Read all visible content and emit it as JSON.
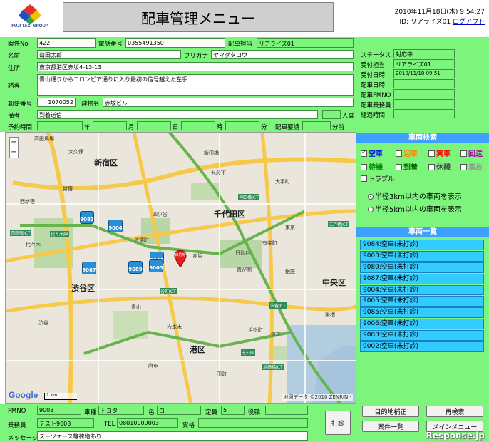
{
  "header": {
    "logo_text": "FUJI TAXI GROUP",
    "title": "配車管理メニュー",
    "datetime": "2010年11月18日(木) 9:54:27",
    "user_label": "ID: リアライズ01",
    "logout": "ログアウト"
  },
  "form": {
    "case_no_label": "案件No.",
    "case_no": "422",
    "phone_label": "電話番号",
    "phone": "0355491350",
    "dispatcher_label": "配車担当",
    "dispatcher": "リアライズ01",
    "name_label": "名前",
    "name": "山田太郎",
    "kana_label": "フリガナ",
    "kana": "ヤマダタロウ",
    "address_label": "住所",
    "address": "東京都港区赤坂4-13-13",
    "guide_label": "誘導",
    "guide": "青山通りからコロンビア通りに入り最初の信号越えた左手",
    "zip_label": "郵便番号",
    "zip": "1070052",
    "building_label": "建物名",
    "building": "赤坂ビル",
    "note_label": "備考",
    "note": "到着送信",
    "passengers_label": "人乗",
    "reserve_label": "予約時間",
    "year_label": "年",
    "month_label": "月",
    "day_label": "日",
    "hour_label": "時",
    "minute_label": "分",
    "dispatch_req_label": "配車要請",
    "minutes_after_label": "分前",
    "status_label": "ステータス",
    "status": "対応中",
    "receiver_label": "受付担当",
    "receiver": "リアライズ01",
    "received_at_label": "受付日時",
    "received_at": "2010/11/18 09:51",
    "dispatch_at_label": "配車日時",
    "fmno_label": "配車FMNO",
    "crew_label": "配車乗務員",
    "elapsed_label": "経過時間"
  },
  "vehicle_search": {
    "title": "車両検索",
    "filters": [
      {
        "label": "空車",
        "checked": true,
        "color": "#0000ff"
      },
      {
        "label": "迎車",
        "checked": false,
        "color": "#ff8800"
      },
      {
        "label": "実車",
        "checked": false,
        "color": "#ff0000"
      },
      {
        "label": "回送",
        "checked": false,
        "color": "#aa00aa"
      },
      {
        "label": "待機",
        "checked": false,
        "color": "#008800"
      },
      {
        "label": "到着",
        "checked": false,
        "color": "#006600"
      },
      {
        "label": "休憩",
        "checked": false,
        "color": "#444444"
      },
      {
        "label": "事故",
        "checked": false,
        "color": "#999999"
      },
      {
        "label": "トラブル",
        "checked": false,
        "color": "#333333"
      }
    ],
    "radius_3km": "半径3km以内の車両を表示",
    "radius_5km": "半径5km以内の車両を表示",
    "radius_selected": "3km"
  },
  "vehicle_list": {
    "title": "車両一覧",
    "items": [
      "9084:空車(未打診)",
      "9003:空車(未打診)",
      "9089:空車(未打診)",
      "9087:空車(未打診)",
      "9004:空車(未打診)",
      "9005:空車(未打診)",
      "9085:空車(未打診)",
      "9006:空車(未打診)",
      "9083:空車(未打診)",
      "9002:空車(未打診)"
    ]
  },
  "map": {
    "zoom_in": "+",
    "zoom_out": "−",
    "attribution": "地図データ ©2010 ZENRIN -",
    "logo": "Google",
    "scale_label": "1 km",
    "destination_label": "目的地",
    "areas": [
      "新宿区",
      "千代田区",
      "渋谷区",
      "港区",
      "中央区",
      "新宿",
      "大久保",
      "四ツ谷",
      "信濃町",
      "六本木",
      "赤坂",
      "青山",
      "代々木",
      "西新宿",
      "渋谷",
      "麻布",
      "霞が関",
      "有楽町",
      "日比谷",
      "銀座",
      "竹芝",
      "田町",
      "高田馬場",
      "飯田橋",
      "九段下",
      "大手町",
      "東京",
      "築地",
      "浜松町"
    ],
    "junctions": [
      "西新宿JCT",
      "代々木PA",
      "神田橋JCT",
      "江戸橋JCT",
      "谷町JCT",
      "浜崎橋JCT",
      "汐留JCT",
      "芝公園"
    ],
    "markers": [
      "9083",
      "9004",
      "9005",
      "9087",
      "9089",
      "9003"
    ]
  },
  "bottom": {
    "fmno_label": "FMNO",
    "fmno": "9003",
    "car_label": "車種",
    "car": "トヨタ",
    "color_label": "色",
    "color": "白",
    "capacity_label": "定員",
    "capacity": "5",
    "role_label": "役職",
    "driver_label": "乗務員",
    "driver": "テスト9003",
    "tel_label": "TEL",
    "tel": "08010009003",
    "qualification_label": "資格",
    "message_label": "メッセージ",
    "message": "スーツケース等荷物あり",
    "call_button": "打診",
    "dest_fix_button": "目的地補正",
    "case_list_button": "案件一覧",
    "research_button": "再検索",
    "main_menu_button": "メインメニュー",
    "watermark": "Response.jp"
  }
}
